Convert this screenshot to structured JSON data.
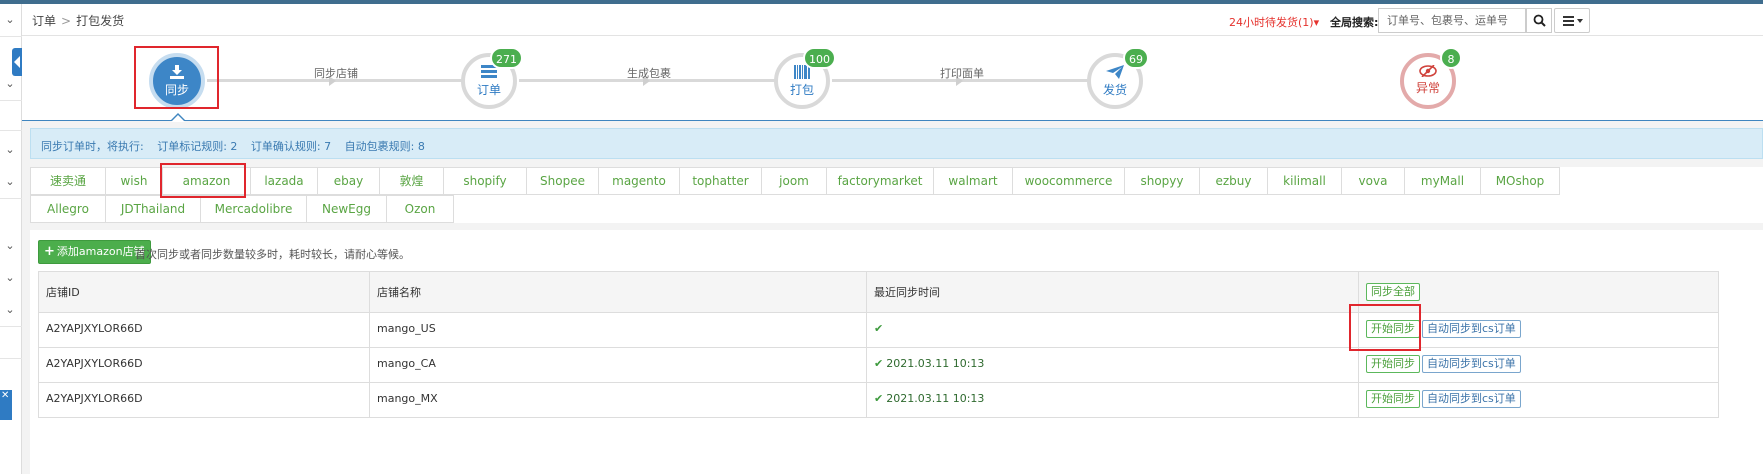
{
  "breadcrumb": {
    "root": "订单",
    "current": "打包发货"
  },
  "header": {
    "pending": "24小时待发货(1)",
    "global_search_label": "全局搜索:",
    "global_search_placeholder": "订单号、包裹号、运单号"
  },
  "steps": {
    "items": [
      {
        "label": "同步",
        "badge": ""
      },
      {
        "label": "订单",
        "badge": "271"
      },
      {
        "label": "打包",
        "badge": "100"
      },
      {
        "label": "发货",
        "badge": "69"
      },
      {
        "label": "异常",
        "badge": "8"
      }
    ],
    "connectors": [
      "同步店铺",
      "生成包裹",
      "打印面单"
    ]
  },
  "info": {
    "prefix": "同步订单时，将执行:",
    "rule1": "订单标记规则: 2",
    "rule2": "订单确认规则: 7",
    "rule3": "自动包裹规则: 8"
  },
  "platforms": [
    "速卖通",
    "wish",
    "amazon",
    "lazada",
    "ebay",
    "敦煌",
    "shopify",
    "Shopee",
    "magento",
    "tophatter",
    "joom",
    "factorymarket",
    "walmart",
    "woocommerce",
    "shopyy",
    "ezbuy",
    "kilimall",
    "vova",
    "myMall",
    "MOshop",
    "Allegro",
    "JDThailand",
    "Mercadolibre",
    "NewEgg",
    "Ozon"
  ],
  "content": {
    "add_button": "添加amazon店铺",
    "hint": "首次同步或者同步数量较多时，耗时较长，请耐心等候。"
  },
  "table": {
    "headers": [
      "店铺ID",
      "店铺名称",
      "最近同步时间"
    ],
    "sync_all": "同步全部",
    "start_sync": "开始同步",
    "auto_sync": "自动同步到cs订单",
    "rows": [
      {
        "id": "A2YAPJXYLOR66D",
        "name": "mango_US",
        "time": ""
      },
      {
        "id": "A2YAPJXYLOR66D",
        "name": "mango_CA",
        "time": "2021.03.11 10:13"
      },
      {
        "id": "A2YAPJXYLOR66D",
        "name": "mango_MX",
        "time": "2021.03.11 10:13"
      }
    ]
  },
  "colors": {
    "accent": "#3d86c7",
    "green": "#5aa544",
    "badge": "#4bae4f",
    "alert": "#e5322d"
  }
}
